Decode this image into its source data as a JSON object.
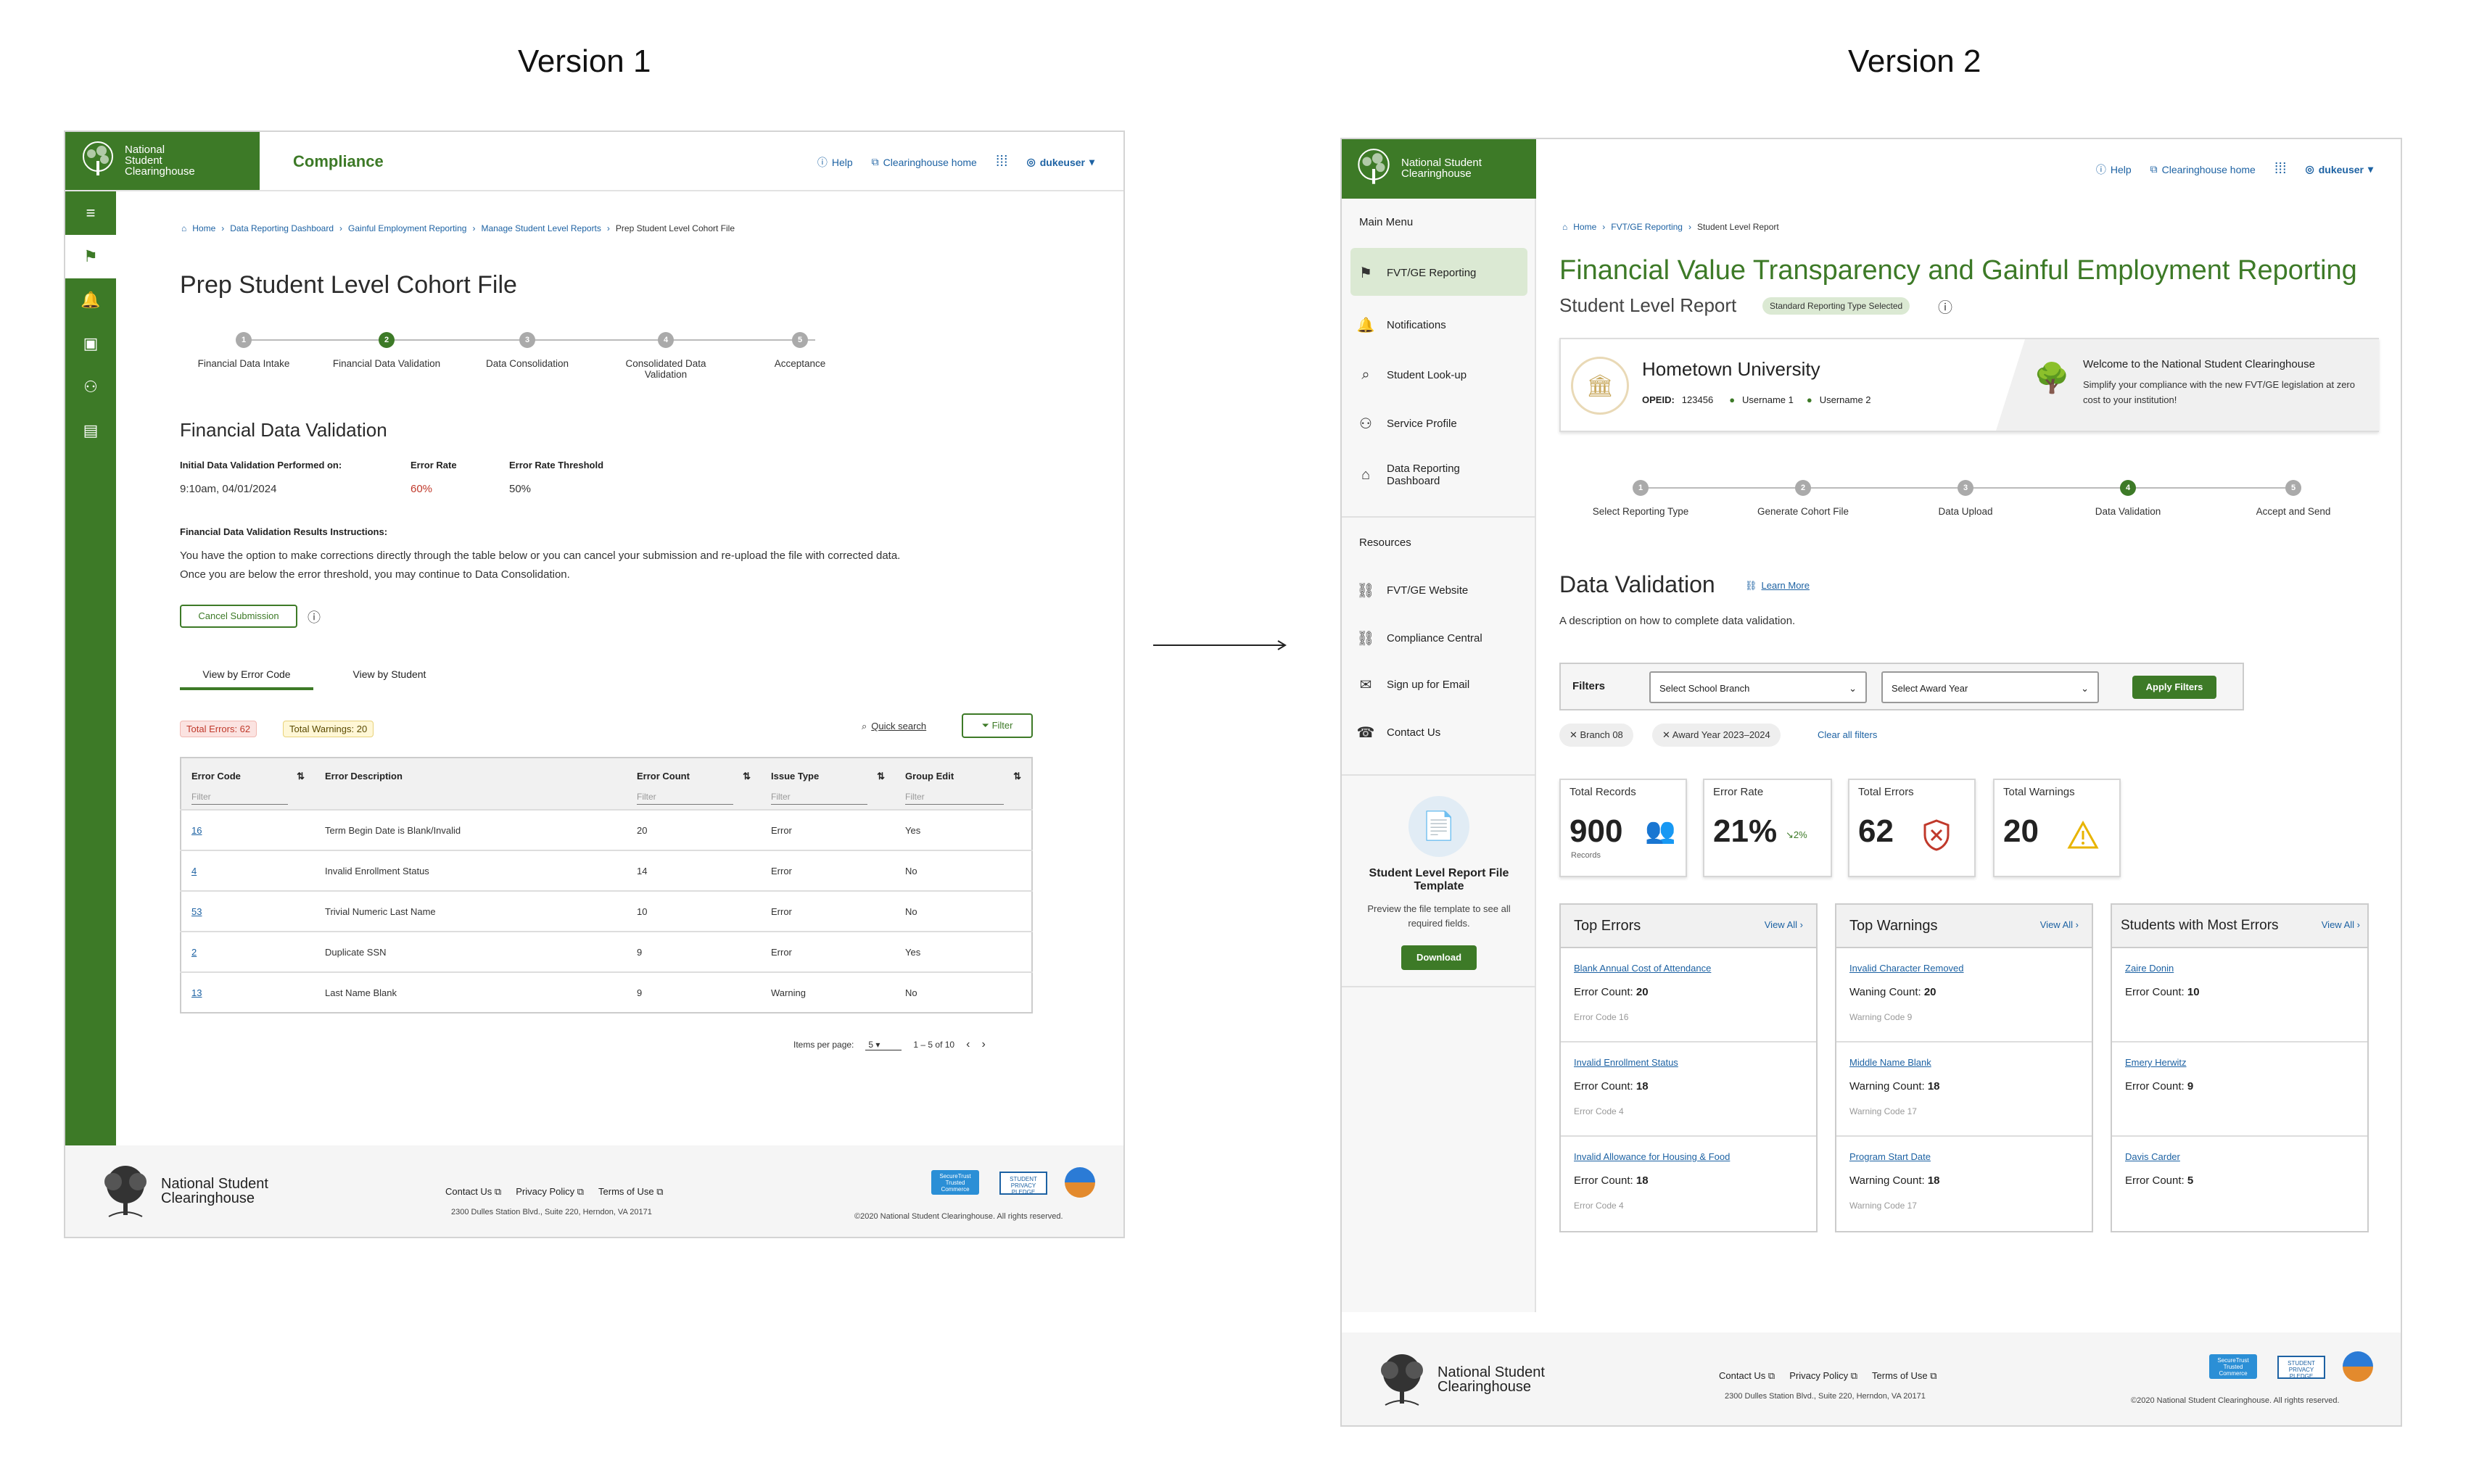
{
  "titles": {
    "v1": "Version 1",
    "v2": "Version 2"
  },
  "common": {
    "brand": "National Student Clearinghouse",
    "help": "Help",
    "ch_home": "Clearinghouse home",
    "user": "dukeuser",
    "footer": {
      "contact": "Contact Us",
      "privacy": "Privacy Policy",
      "terms": "Terms of Use",
      "address": "2300 Dulles Station Blvd., Suite 220, Herndon, VA 20171",
      "copyright": "©2020 National Student Clearinghouse. All rights reserved.",
      "badge1": "SecureTrust Trusted Commerce",
      "badge2": "STUDENT PRIVACY PLEDGE"
    }
  },
  "v1": {
    "app_title": "Compliance",
    "breadcrumb": [
      "Home",
      "Data Reporting Dashboard",
      "Gainful Employment Reporting",
      "Manage Student Level Reports",
      "Prep Student Level Cohort File"
    ],
    "page_title": "Prep Student Level Cohort File",
    "steps": [
      "Financial Data Intake",
      "Financial Data Validation",
      "Data Consolidation",
      "Consolidated Data Validation",
      "Acceptance"
    ],
    "section_title": "Financial Data Validation",
    "meta": {
      "performed_label": "Initial Data Validation Performed on:",
      "performed_value": "9:10am, 04/01/2024",
      "rate_label": "Error Rate",
      "rate_value": "60%",
      "threshold_label": "Error Rate Threshold",
      "threshold_value": "50%"
    },
    "instructions_title": "Financial Data Validation Results Instructions:",
    "instructions_1": "You have the option to make corrections directly through the table below or you can cancel your submission and re-upload the file with corrected data.",
    "instructions_2": "Once you are below the error threshold, you may continue to Data Consolidation.",
    "cancel_button": "Cancel Submission",
    "tabs": [
      "View by Error Code",
      "View by Student"
    ],
    "total_errors": "Total Errors: 62",
    "total_warnings": "Total Warnings: 20",
    "quick_search": "Quick search",
    "filter": "Filter",
    "columns": [
      "Error Code",
      "Error Description",
      "Error Count",
      "Issue Type",
      "Group Edit"
    ],
    "filter_placeholder": "Filter",
    "rows": [
      [
        "16",
        "Term Begin Date is Blank/Invalid",
        "20",
        "Error",
        "Yes"
      ],
      [
        "4",
        "Invalid Enrollment Status",
        "14",
        "Error",
        "No"
      ],
      [
        "53",
        "Trivial Numeric Last Name",
        "10",
        "Error",
        "No"
      ],
      [
        "2",
        "Duplicate SSN",
        "9",
        "Error",
        "Yes"
      ],
      [
        "13",
        "Last Name Blank",
        "9",
        "Warning",
        "No"
      ]
    ],
    "pager": {
      "label": "Items per page:",
      "value": "5",
      "range": "1 – 5 of 10"
    }
  },
  "v2": {
    "menu_title": "Main Menu",
    "menu": [
      "FVT/GE Reporting",
      "Notifications",
      "Student Look-up",
      "Service Profile",
      "Data Reporting Dashboard"
    ],
    "resources_title": "Resources",
    "resources": [
      "FVT/GE Website",
      "Compliance Central",
      "Sign up for Email",
      "Contact Us"
    ],
    "template": {
      "title": "Student Level Report File Template",
      "desc": "Preview the file template to see all required fields.",
      "button": "Download"
    },
    "breadcrumb": [
      "Home",
      "FVT/GE Reporting",
      "Student Level Report"
    ],
    "page_title": "Financial Value Transparency and Gainful Employment Reporting",
    "subtitle": "Student Level Report",
    "subtitle_badge": "Standard Reporting Type Selected",
    "institution": {
      "name": "Hometown University",
      "opeid_label": "OPEID:",
      "opeid": "123456",
      "user1": "Username 1",
      "user2": "Username 2",
      "welcome_title": "Welcome to the National Student Clearinghouse",
      "welcome_text": "Simplify your compliance with the new FVT/GE legislation at zero cost to your institution!"
    },
    "steps": [
      "Select Reporting Type",
      "Generate Cohort File",
      "Data Upload",
      "Data Validation",
      "Accept and Send"
    ],
    "section_title": "Data Validation",
    "learn_more": "Learn More",
    "section_desc": "A description on how to complete data validation.",
    "filters": {
      "label": "Filters",
      "branch_placeholder": "Select School Branch",
      "year_placeholder": "Select Award Year",
      "apply": "Apply Filters",
      "chips": [
        "Branch 08",
        "Award Year 2023–2024"
      ],
      "clear": "Clear all filters"
    },
    "stats": [
      {
        "title": "Total Records",
        "value": "900",
        "sub": "Records"
      },
      {
        "title": "Error Rate",
        "value": "21%",
        "sub": "2%"
      },
      {
        "title": "Total Errors",
        "value": "62",
        "sub": ""
      },
      {
        "title": "Total Warnings",
        "value": "20",
        "sub": ""
      }
    ],
    "view_all": "View All",
    "panels": [
      {
        "title": "Top Errors",
        "items": [
          {
            "name": "Blank Annual Cost of Attendance",
            "count_label": "Error Count:",
            "count": "20",
            "code": "Error Code 16"
          },
          {
            "name": "Invalid Enrollment Status",
            "count_label": "Error Count:",
            "count": "18",
            "code": "Error Code 4"
          },
          {
            "name": "Invalid Allowance for Housing & Food",
            "count_label": "Error Count:",
            "count": "18",
            "code": "Error Code 4"
          }
        ]
      },
      {
        "title": "Top Warnings",
        "items": [
          {
            "name": "Invalid Character Removed",
            "count_label": "Waning Count:",
            "count": "20",
            "code": "Warning Code 9"
          },
          {
            "name": "Middle Name Blank",
            "count_label": "Warning Count:",
            "count": "18",
            "code": "Warning Code 17"
          },
          {
            "name": "Program Start Date",
            "count_label": "Warning Count:",
            "count": "18",
            "code": "Warning Code 17"
          }
        ]
      },
      {
        "title": "Students with Most Errors",
        "items": [
          {
            "name": "Zaire Donin",
            "count_label": "Error Count:",
            "count": "10",
            "code": ""
          },
          {
            "name": "Emery Herwitz",
            "count_label": "Error Count:",
            "count": "9",
            "code": ""
          },
          {
            "name": "Davis Carder",
            "count_label": "Error Count:",
            "count": "5",
            "code": ""
          }
        ]
      }
    ]
  },
  "colors": {
    "brand_green": "#3d7a27",
    "link_blue": "#1d62a3",
    "error_red": "#c0392b",
    "warning_yellow": "#e8b400"
  }
}
